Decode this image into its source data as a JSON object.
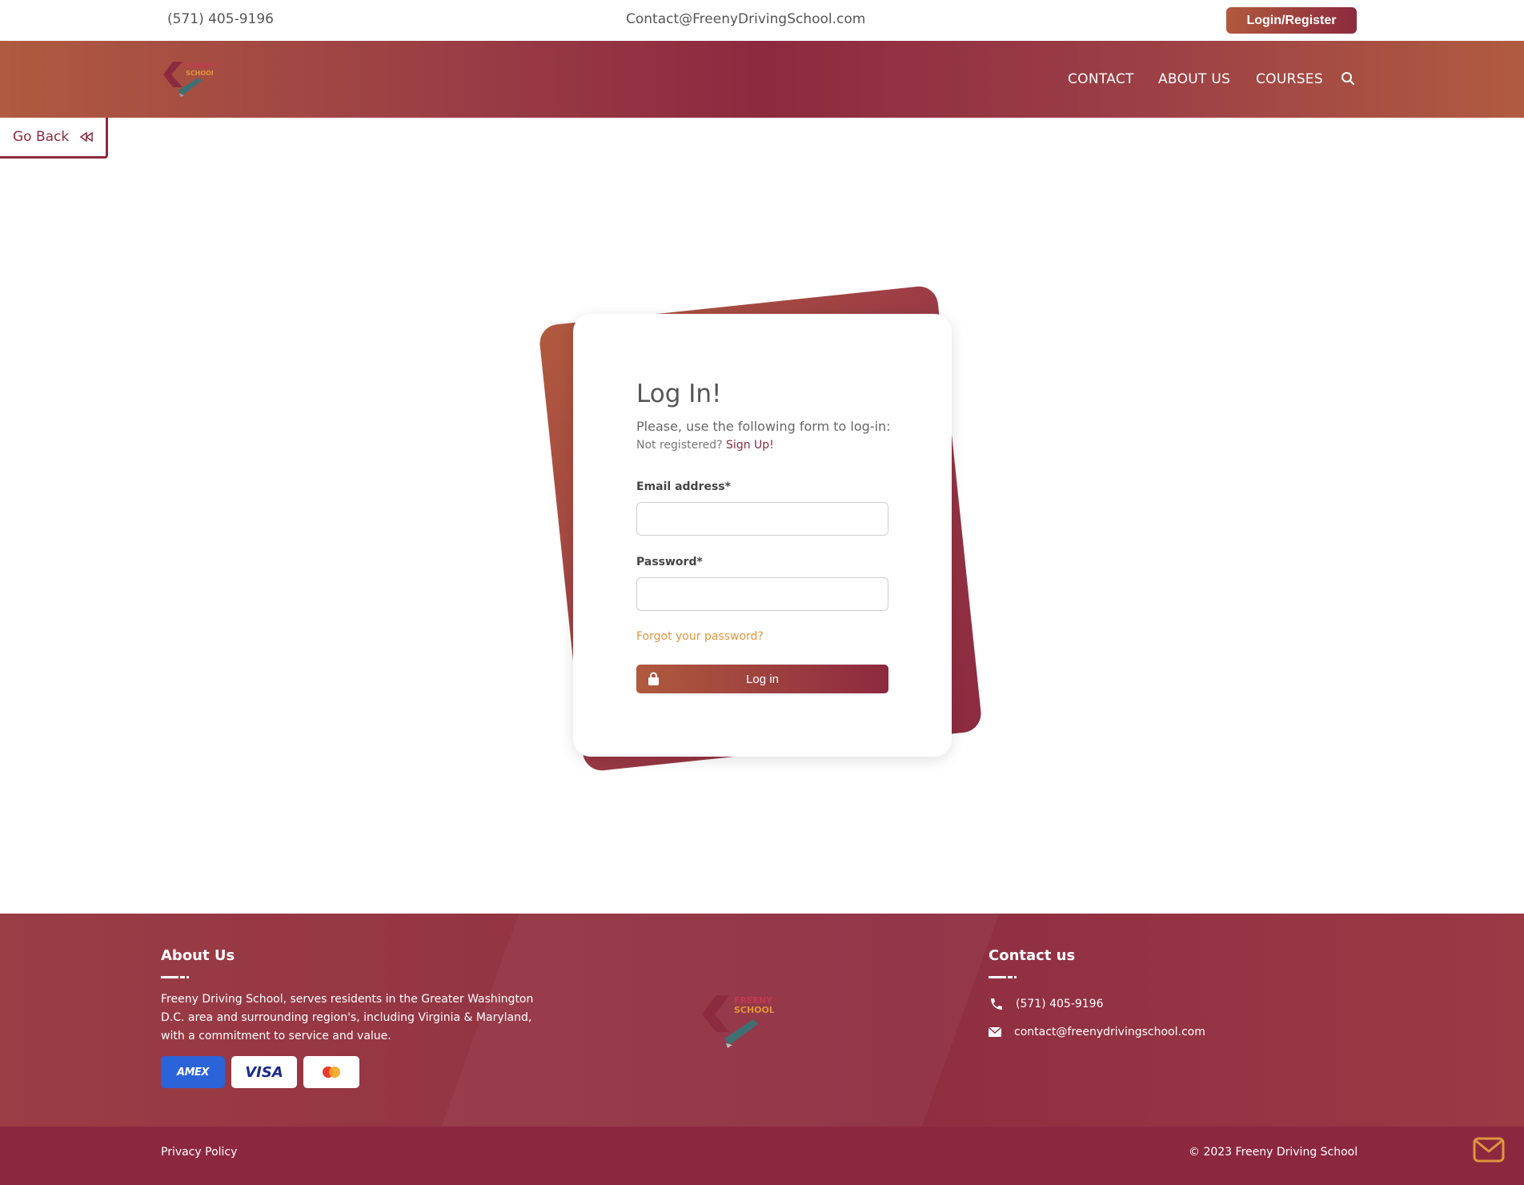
{
  "topbar": {
    "phone": "(571) 405-9196",
    "email": "Contact@FreenyDrivingSchool.com",
    "login_register": "Login/Register"
  },
  "nav": {
    "links": [
      "CONTACT",
      "ABOUT US",
      "COURSES"
    ],
    "search_icon": "search-icon",
    "logo_alt": "Freeny Driving School logo"
  },
  "go_back": {
    "label": "Go Back",
    "icon": "rewind-icon"
  },
  "login_form": {
    "title": "Log In!",
    "subtitle": "Please, use the following form to log-in:",
    "not_registered": "Not registered?",
    "sign_up": "Sign Up!",
    "email_label": "Email address*",
    "email_value": "",
    "password_label": "Password*",
    "password_value": "",
    "forgot": "Forgot your password?",
    "submit": "Log in",
    "submit_icon": "lock-icon"
  },
  "footer": {
    "about_title": "About Us",
    "about_text": "Freeny Driving School, serves residents in the Greater Washington D.C. area and surrounding region's, including Virginia & Maryland, with a commitment to service and value.",
    "payment_cards": [
      "AMEX",
      "VISA",
      "Mastercard"
    ],
    "contact_title": "Contact us",
    "contact_phone": "(571) 405-9196",
    "contact_email": "contact@freenydrivingschool.com"
  },
  "bottombar": {
    "privacy": "Privacy Policy",
    "copyright": "© 2023 Freeny Driving School",
    "mail_icon": "mail-icon"
  },
  "colors": {
    "brand": "#8c2a40",
    "brand_secondary": "#b05a3e",
    "accent": "#e0953c",
    "amex_blue": "#2b63d9"
  }
}
